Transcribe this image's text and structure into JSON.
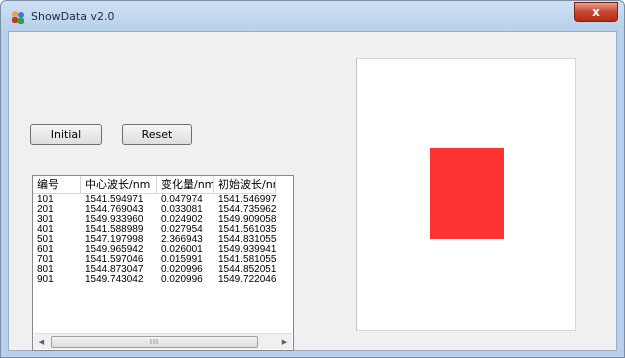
{
  "window": {
    "title": "ShowData v2.0",
    "close_glyph": "x",
    "icon": "app-people-icon"
  },
  "buttons": {
    "initial_label": "Initial",
    "reset_label": "Reset"
  },
  "table": {
    "columns": [
      "编号",
      "中心波长/nm",
      "变化量/nm",
      "初始波长/nm"
    ],
    "rows": [
      [
        "101",
        "1541.594971",
        "0.047974",
        "1541.546997"
      ],
      [
        "201",
        "1544.769043",
        "0.033081",
        "1544.735962"
      ],
      [
        "301",
        "1549.933960",
        "0.024902",
        "1549.909058"
      ],
      [
        "401",
        "1541.588989",
        "0.027954",
        "1541.561035"
      ],
      [
        "501",
        "1547.197998",
        "2.366943",
        "1544.831055"
      ],
      [
        "601",
        "1549.965942",
        "0.026001",
        "1549.939941"
      ],
      [
        "701",
        "1541.597046",
        "0.015991",
        "1541.581055"
      ],
      [
        "801",
        "1544.873047",
        "0.020996",
        "1544.852051"
      ],
      [
        "901",
        "1549.743042",
        "0.020996",
        "1549.722046"
      ]
    ],
    "scroll_left_glyph": "◀",
    "scroll_right_glyph": "▶",
    "scroll_grip_glyph": "III"
  },
  "canvas": {
    "indicator_color": "#ff3333"
  }
}
